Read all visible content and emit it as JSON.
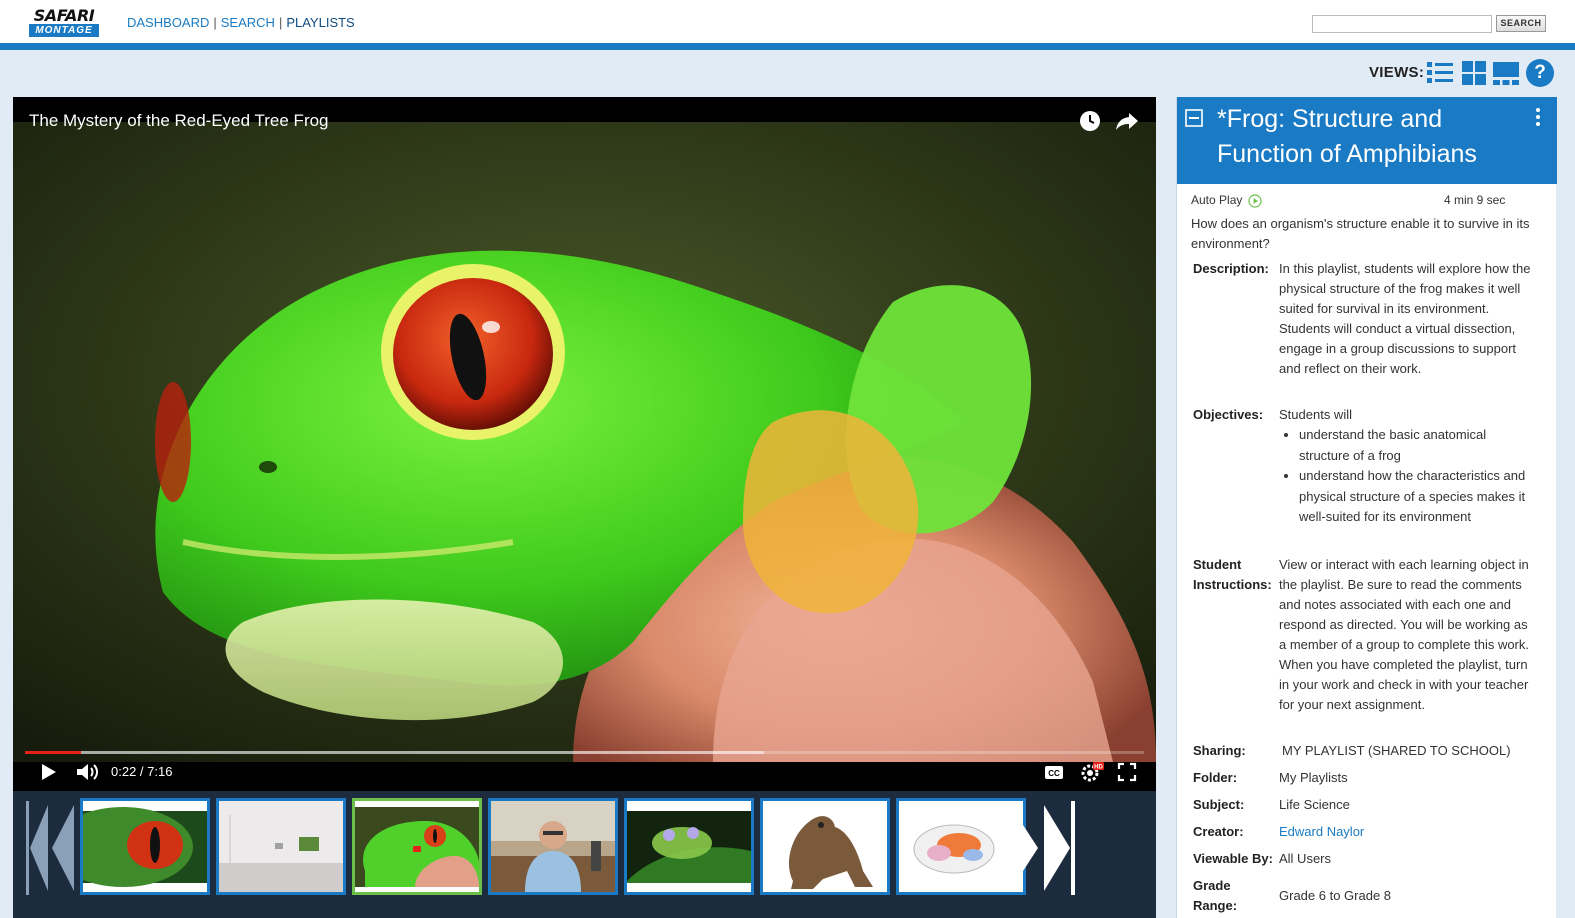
{
  "brand": {
    "name_top": "SAFARI",
    "name_bottom": "MONTAGE"
  },
  "nav": {
    "items": [
      "DASHBOARD",
      "SEARCH",
      "PLAYLISTS"
    ],
    "separator": "|",
    "active": "PLAYLISTS"
  },
  "search": {
    "value": "",
    "placeholder": "",
    "button_label": "SEARCH"
  },
  "views": {
    "label": "VIEWS:",
    "icons": [
      "list-view-icon",
      "grid-view-icon",
      "filmstrip-view-icon",
      "help-icon"
    ],
    "help_glyph": "?"
  },
  "player": {
    "title": "The Mystery of the Red-Eyed Tree Frog",
    "time": "0:22 / 7:16",
    "progress_fraction": 0.05,
    "buffered_fraction": 0.66,
    "controls": [
      "play-icon",
      "volume-icon",
      "captions-icon",
      "settings-hd-icon",
      "fullscreen-icon"
    ],
    "top_icons": [
      "watch-later-clock-icon",
      "share-arrow-icon"
    ],
    "cc_label": "CC",
    "hd_label": "HD"
  },
  "thumbnails": [
    {
      "name": "red-eye-closeup"
    },
    {
      "name": "lab-room"
    },
    {
      "name": "red-eyed-tree-frog",
      "active": true
    },
    {
      "name": "scientist-in-lab"
    },
    {
      "name": "glass-frog-on-leaf"
    },
    {
      "name": "brown-frog-model"
    },
    {
      "name": "frog-anatomy-diagram"
    }
  ],
  "playlist": {
    "title": "*Frog: Structure and Function of Amphibians",
    "autoplay_label": "Auto Play",
    "duration": "4 min 9 sec",
    "question": "How does an organism's structure enable it to survive in its environment?",
    "description_label": "Description:",
    "description": "In this playlist, students will explore how the physical structure of the frog makes it well suited for survival in its environment.  Students will conduct a virtual dissection, engage in a group discussions to support and reflect on their work.",
    "objectives_label": "Objectives:",
    "objectives_intro": "Students will",
    "objectives": [
      "understand the basic anatomical structure of a frog",
      "understand how the characteristics and physical structure of a species makes it well-suited for its environment"
    ],
    "instructions_label_1": "Student",
    "instructions_label_2": "Instructions:",
    "instructions": "View or interact with each learning object in the playlist.  Be sure to read the comments and notes associated with each one and respond as directed.  You will be working as a member of a group to complete this work.  When you have completed the playlist, turn in your work and check in with your teacher for your next assignment.",
    "sharing_label": "Sharing:",
    "sharing": "MY PLAYLIST (SHARED TO SCHOOL)",
    "folder_label": "Folder:",
    "folder": "My Playlists",
    "subject_label": "Subject:",
    "subject": "Life Science",
    "creator_label": "Creator:",
    "creator": "Edward Naylor",
    "viewable_label": "Viewable By:",
    "viewable": "All Users",
    "grade_label_1": "Grade",
    "grade_label_2": "Range:",
    "grade": "Grade 6 to Grade 8"
  },
  "colors": {
    "brand_blue": "#1a7bc4",
    "page_bg": "#e1ebf5",
    "strip_bg": "#1c2c3e",
    "progress_red": "#e62117",
    "active_thumb": "#6cc04a"
  }
}
